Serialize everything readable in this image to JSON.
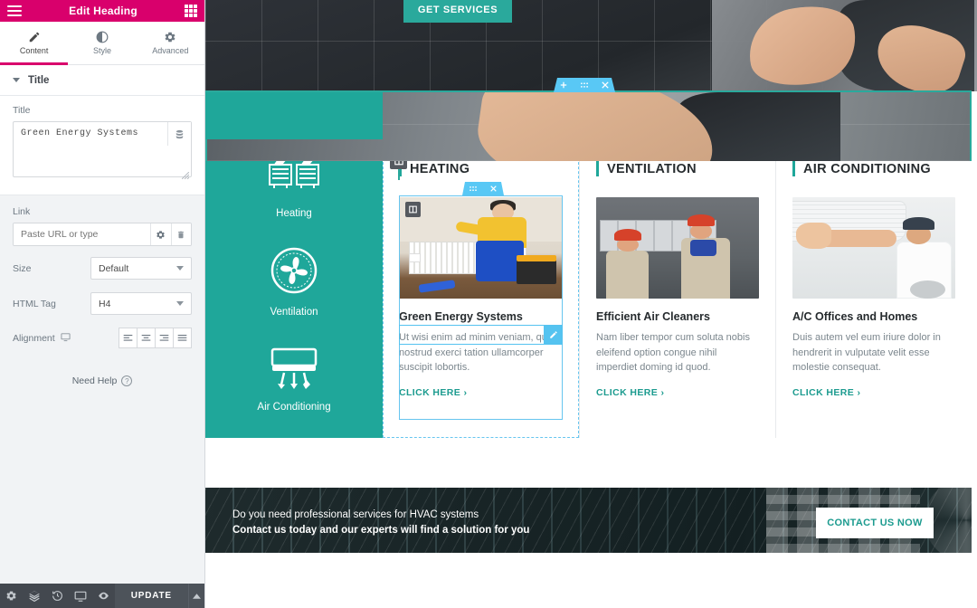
{
  "editor": {
    "header": {
      "title": "Edit Heading",
      "menu_icon": "hamburger-icon",
      "apps_icon": "grid-apps-icon"
    },
    "tabs": [
      {
        "label": "Content",
        "icon": "pencil-icon",
        "active": true
      },
      {
        "label": "Style",
        "icon": "contrast-circle-icon",
        "active": false
      },
      {
        "label": "Advanced",
        "icon": "gear-icon",
        "active": false
      }
    ],
    "section": {
      "label": "Title",
      "expanded": true
    },
    "controls": {
      "title": {
        "label": "Title",
        "value": "Green Energy Systems",
        "action_icon": "database-icon"
      },
      "link": {
        "label": "Link",
        "value": "",
        "placeholder": "Paste URL or type",
        "settings_icon": "gear-icon",
        "clear_icon": "trash-icon"
      },
      "size": {
        "label": "Size",
        "value": "Default"
      },
      "html_tag": {
        "label": "HTML Tag",
        "value": "H4"
      },
      "alignment": {
        "label": "Alignment",
        "device_icon": "desktop-icon",
        "options": [
          "align-left",
          "align-center",
          "align-right",
          "align-justify"
        ]
      }
    },
    "need_help": {
      "label": "Need Help",
      "icon": "question-circle-icon"
    },
    "footer": {
      "icons": [
        "settings-gear-icon",
        "navigator-layers-icon",
        "history-revisions-icon",
        "responsive-mode-icon",
        "preview-eye-icon"
      ],
      "update_label": "UPDATE",
      "caret_icon": "chevron-up-icon"
    }
  },
  "canvas": {
    "hero": {
      "button_label": "GET SERVICES"
    },
    "section_toolbar": {
      "add_icon": "plus-icon",
      "drag_icon": "drag-dots-icon",
      "close_icon": "close-x-icon"
    },
    "widget_toolbar": {
      "drag_icon": "drag-dots-icon",
      "close_icon": "close-x-icon"
    },
    "column_handle_icon": "column-handle-icon",
    "image_handle_icon": "column-handle-icon",
    "edit_badge_icon": "pencil-edit-icon",
    "collapse_handle_icon": "chevron-left-icon",
    "services": [
      {
        "label": "Heating",
        "icon": "radiator-icon"
      },
      {
        "label": "Ventilation",
        "icon": "fan-icon"
      },
      {
        "label": "Air Conditioning",
        "icon": "air-conditioner-icon"
      }
    ],
    "cards": [
      {
        "heading": "HEATING",
        "title": "Green Energy Systems",
        "body": "Ut wisi enim ad minim veniam, quis nostrud exerci tation ullamcorper suscipit lobortis.",
        "link": "CLICK HERE ›",
        "image": "technician-thumbs-up-radiator",
        "selected": true
      },
      {
        "heading": "VENTILATION",
        "title": "Efficient Air Cleaners",
        "body": "Nam liber tempor cum soluta nobis eleifend option congue nihil imperdiet doming id quod.",
        "link": "CLICK HERE ›",
        "image": "workers-installing-duct",
        "selected": false
      },
      {
        "heading": "AIR CONDITIONING",
        "title": "A/C Offices and Homes",
        "body": "Duis autem vel eum iriure dolor in hendrerit in vulputate velit esse molestie consequat.",
        "link": "CLICK HERE ›",
        "image": "man-installing-ac-unit",
        "selected": false
      }
    ],
    "cta": {
      "line1": "Do you need professional services for HVAC systems",
      "line2": "Contact us today and our experts will find a solution for you",
      "button_label": "CONTACT US NOW"
    }
  },
  "colors": {
    "brand_pink": "#d9006c",
    "teal": "#1fa79a",
    "link_teal": "#1c9b8f",
    "select_blue": "#59c8f5",
    "panel_bg": "#f1f3f5",
    "footer_dark": "#43484f"
  }
}
